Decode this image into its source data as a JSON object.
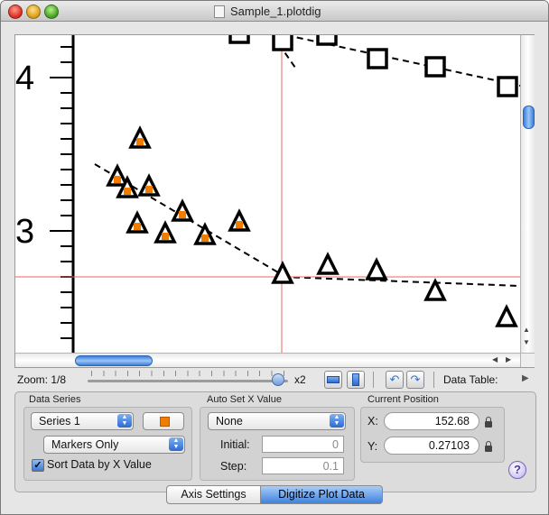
{
  "window": {
    "title": "Sample_1.plotdig"
  },
  "plot": {
    "axis_labels": [
      "4",
      "3"
    ],
    "colors": {
      "marker_fill": "#f07d00",
      "crosshair": "#f06060",
      "marker_stroke": "#000000"
    }
  },
  "zoom": {
    "label": "Zoom: 1/8",
    "max_label": "x2"
  },
  "data_table_label": "Data Table:",
  "data_series": {
    "group_label": "Data Series",
    "series_value": "Series 1",
    "style_value": "Markers Only",
    "sort_label": "Sort Data by X Value",
    "sort_checked": true,
    "marker_color": "#f07d00"
  },
  "auto_set_x": {
    "group_label": "Auto Set X Value",
    "mode_value": "None",
    "initial_label": "Initial:",
    "initial_value": "0",
    "step_label": "Step:",
    "step_value": "0.1"
  },
  "current_position": {
    "group_label": "Current Position",
    "x_label": "X:",
    "x_value": "152.68",
    "y_label": "Y:",
    "y_value": "0.27103"
  },
  "help_label": "?",
  "tabs": [
    {
      "label": "Axis Settings",
      "active": false
    },
    {
      "label": "Digitize Plot Data",
      "active": true
    }
  ]
}
